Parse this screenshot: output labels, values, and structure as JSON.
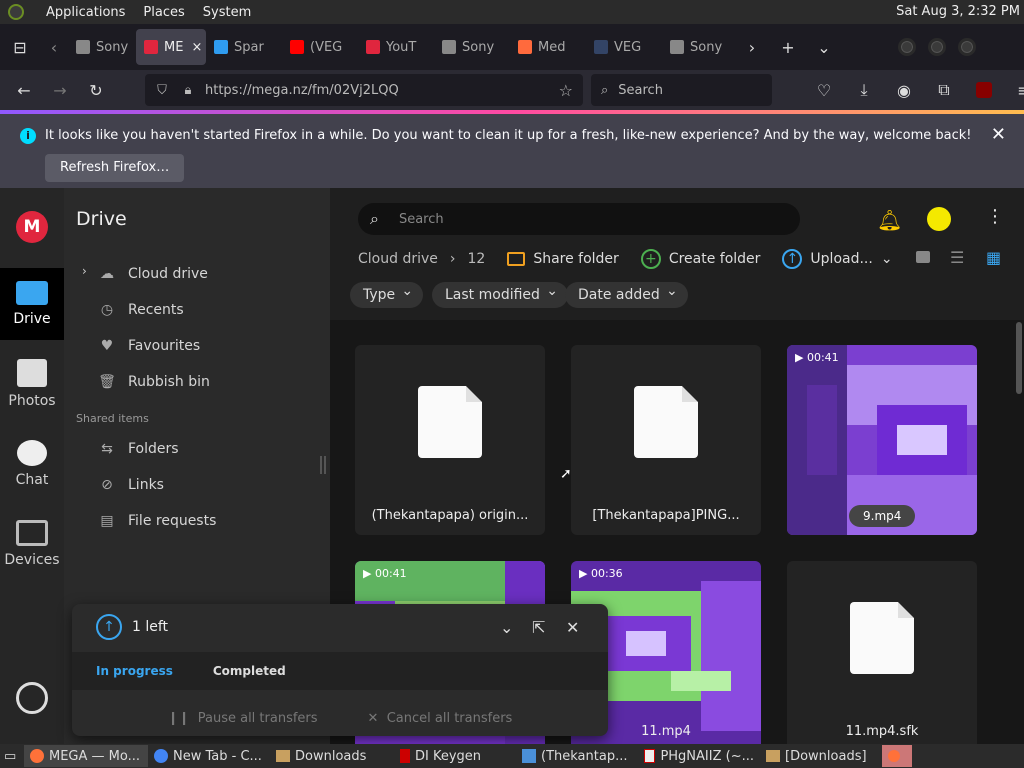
{
  "system_panel": {
    "menus": [
      "Applications",
      "Places",
      "System"
    ],
    "clock": "Sat Aug  3,  2:32 PM"
  },
  "tabs": [
    {
      "label": "Sony",
      "favicon": "museum-icon",
      "color": "#888888"
    },
    {
      "label": "ME",
      "favicon": "mega-icon",
      "color": "#e0263e"
    },
    {
      "label": "Spar",
      "favicon": "spark-icon",
      "color": "#2f9cf0"
    },
    {
      "label": "(VEG",
      "favicon": "youtube-icon",
      "color": "#ff0000"
    },
    {
      "label": "YouT",
      "favicon": "download-icon",
      "color": "#e0263e"
    },
    {
      "label": "Sony",
      "favicon": "museum-icon",
      "color": "#888888"
    },
    {
      "label": "Med",
      "favicon": "medium-icon",
      "color": "#ff6a3d"
    },
    {
      "label": "VEG",
      "favicon": "vega-icon",
      "color": "#334466"
    },
    {
      "label": "Sony",
      "favicon": "museum-icon",
      "color": "#888888"
    }
  ],
  "navbar": {
    "url": "https://mega.nz/fm/02Vj2LQQ",
    "search_placeholder": "Search"
  },
  "notification": {
    "message": "It looks like you haven't started Firefox in a while. Do you want to clean it up for a fresh, like-new experience? And by the way, welcome back!",
    "refresh_label": "Refresh Firefox…"
  },
  "rail": {
    "items": [
      "Drive",
      "Photos",
      "Chat",
      "Devices"
    ]
  },
  "sidebar": {
    "title": "Drive",
    "items": [
      "Cloud drive",
      "Recents",
      "Favourites",
      "Rubbish bin"
    ],
    "shared_label": "Shared items",
    "shared_items": [
      "Folders",
      "Links",
      "File requests"
    ]
  },
  "main": {
    "search_placeholder": "Search",
    "breadcrumb_root": "Cloud drive",
    "breadcrumb_current": "12",
    "share_folder": "Share folder",
    "create_folder": "Create folder",
    "upload": "Upload...",
    "filters": [
      "Type",
      "Last modified",
      "Date added"
    ]
  },
  "files": [
    {
      "name": "(Thekantapapa) origin...",
      "kind": "doc"
    },
    {
      "name": "[Thekantapapa]PING...",
      "kind": "doc"
    },
    {
      "name": "9.mp4",
      "kind": "video",
      "duration": "00:41"
    },
    {
      "name": "",
      "kind": "video",
      "duration": "00:41"
    },
    {
      "name": "11.mp4",
      "kind": "video",
      "duration": "00:36"
    },
    {
      "name": "11.mp4.sfk",
      "kind": "doc"
    }
  ],
  "transfers": {
    "status": "1 left",
    "tab_in_progress": "In progress",
    "tab_completed": "Completed",
    "pause_all": "Pause all transfers",
    "cancel_all": "Cancel all transfers"
  },
  "taskbar": {
    "items": [
      {
        "label": "MEGA — Mo...",
        "icon": "firefox-icon"
      },
      {
        "label": "New Tab - C...",
        "icon": "chrome-icon"
      },
      {
        "label": "Downloads",
        "icon": "folder-icon"
      },
      {
        "label": "DI Keygen",
        "icon": "keygen-icon"
      },
      {
        "label": "(Thekantap...",
        "icon": "audio-icon"
      },
      {
        "label": "PHgNAIIZ (~...",
        "icon": "editor-icon"
      },
      {
        "label": "[Downloads]",
        "icon": "folder-icon"
      }
    ]
  }
}
